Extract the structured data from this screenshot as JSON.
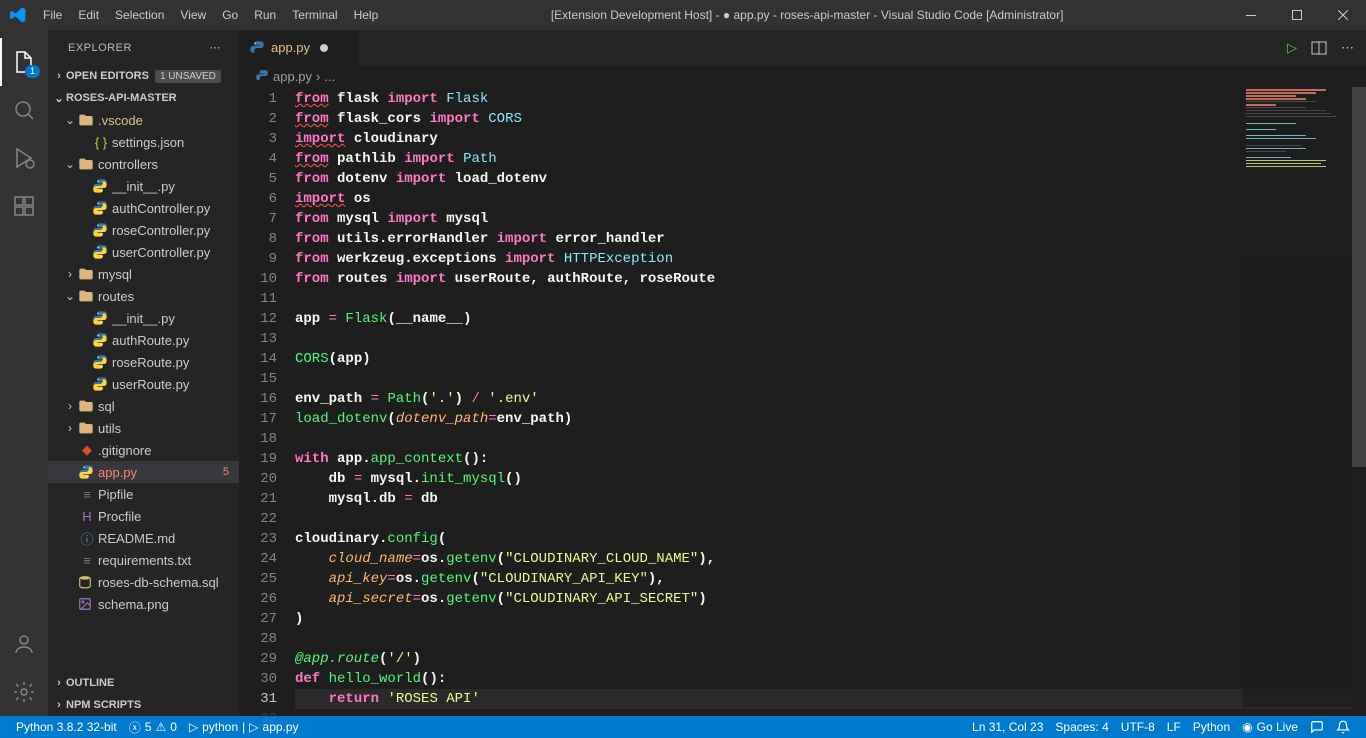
{
  "title": "[Extension Development Host] - ● app.py - roses-api-master - Visual Studio Code [Administrator]",
  "menu": [
    "File",
    "Edit",
    "Selection",
    "View",
    "Go",
    "Run",
    "Terminal",
    "Help"
  ],
  "explorer": {
    "title": "EXPLORER",
    "openEditors": "OPEN EDITORS",
    "unsavedBadge": "1 UNSAVED",
    "root": "ROSES-API-MASTER",
    "outline": "OUTLINE",
    "npm": "NPM SCRIPTS"
  },
  "tree": [
    {
      "d": 1,
      "t": "folder",
      "open": true,
      "name": ".vscode",
      "mod": true
    },
    {
      "d": 2,
      "t": "json",
      "name": "settings.json"
    },
    {
      "d": 1,
      "t": "folder",
      "open": true,
      "name": "controllers"
    },
    {
      "d": 2,
      "t": "py",
      "name": "__init__.py"
    },
    {
      "d": 2,
      "t": "py",
      "name": "authController.py"
    },
    {
      "d": 2,
      "t": "py",
      "name": "roseController.py"
    },
    {
      "d": 2,
      "t": "py",
      "name": "userController.py"
    },
    {
      "d": 1,
      "t": "folder",
      "open": false,
      "name": "mysql"
    },
    {
      "d": 1,
      "t": "folder",
      "open": true,
      "name": "routes"
    },
    {
      "d": 2,
      "t": "py",
      "name": "__init__.py"
    },
    {
      "d": 2,
      "t": "py",
      "name": "authRoute.py"
    },
    {
      "d": 2,
      "t": "py",
      "name": "roseRoute.py"
    },
    {
      "d": 2,
      "t": "py",
      "name": "userRoute.py"
    },
    {
      "d": 1,
      "t": "folder",
      "open": false,
      "name": "sql"
    },
    {
      "d": 1,
      "t": "folder",
      "open": false,
      "name": "utils"
    },
    {
      "d": 1,
      "t": "gitignore",
      "name": ".gitignore"
    },
    {
      "d": 1,
      "t": "py",
      "name": "app.py",
      "err": true,
      "sel": true,
      "decor": "5"
    },
    {
      "d": 1,
      "t": "txt",
      "name": "Pipfile"
    },
    {
      "d": 1,
      "t": "procfile",
      "name": "Procfile"
    },
    {
      "d": 1,
      "t": "md",
      "name": "README.md"
    },
    {
      "d": 1,
      "t": "txt",
      "name": "requirements.txt"
    },
    {
      "d": 1,
      "t": "sql",
      "name": "roses-db-schema.sql"
    },
    {
      "d": 1,
      "t": "png",
      "name": "schema.png"
    }
  ],
  "tab": {
    "name": "app.py",
    "dirty": true
  },
  "breadcrumb": {
    "file": "app.py",
    "more": "..."
  },
  "code": {
    "lines": [
      [
        [
          "kw-pink-u",
          "from"
        ],
        [
          "plain",
          " flask "
        ],
        [
          "kw-pink",
          "import"
        ],
        [
          "plain",
          " "
        ],
        [
          "cls",
          "Flask"
        ]
      ],
      [
        [
          "kw-pink-u",
          "from"
        ],
        [
          "plain",
          " flask_cors "
        ],
        [
          "kw-pink",
          "import"
        ],
        [
          "plain",
          " "
        ],
        [
          "cls",
          "CORS"
        ]
      ],
      [
        [
          "kw-pink-u",
          "import"
        ],
        [
          "plain",
          " cloudinary"
        ]
      ],
      [
        [
          "kw-pink-u",
          "from"
        ],
        [
          "plain",
          " pathlib "
        ],
        [
          "kw-pink",
          "import"
        ],
        [
          "plain",
          " "
        ],
        [
          "cls",
          "Path"
        ]
      ],
      [
        [
          "kw-pink",
          "from"
        ],
        [
          "plain",
          " dotenv "
        ],
        [
          "kw-pink",
          "import"
        ],
        [
          "plain",
          " load_dotenv"
        ]
      ],
      [
        [
          "kw-pink-u",
          "import"
        ],
        [
          "plain",
          " os"
        ]
      ],
      [
        [
          "kw-pink",
          "from"
        ],
        [
          "plain",
          " mysql "
        ],
        [
          "kw-pink",
          "import"
        ],
        [
          "plain",
          " mysql"
        ]
      ],
      [
        [
          "kw-pink",
          "from"
        ],
        [
          "plain",
          " utils.errorHandler "
        ],
        [
          "kw-pink",
          "import"
        ],
        [
          "plain",
          " error_handler"
        ]
      ],
      [
        [
          "kw-pink",
          "from"
        ],
        [
          "plain",
          " werkzeug.exceptions "
        ],
        [
          "kw-pink",
          "import"
        ],
        [
          "plain",
          " "
        ],
        [
          "cls",
          "HTTPException"
        ]
      ],
      [
        [
          "kw-pink",
          "from"
        ],
        [
          "plain",
          " routes "
        ],
        [
          "kw-pink",
          "import"
        ],
        [
          "plain",
          " userRoute, authRoute, roseRoute"
        ]
      ],
      [],
      [
        [
          "plain",
          "app "
        ],
        [
          "op",
          "="
        ],
        [
          "plain",
          " "
        ],
        [
          "fn",
          "Flask"
        ],
        [
          "plain",
          "("
        ],
        [
          "plain",
          "__name__"
        ],
        [
          "plain",
          ")"
        ]
      ],
      [],
      [
        [
          "fn",
          "CORS"
        ],
        [
          "plain",
          "(app)"
        ]
      ],
      [],
      [
        [
          "plain",
          "env_path "
        ],
        [
          "op",
          "="
        ],
        [
          "plain",
          " "
        ],
        [
          "fn",
          "Path"
        ],
        [
          "plain",
          "("
        ],
        [
          "str",
          "'.'"
        ],
        [
          "plain",
          ") "
        ],
        [
          "op",
          "/"
        ],
        [
          "plain",
          " "
        ],
        [
          "str",
          "'.env'"
        ]
      ],
      [
        [
          "fn",
          "load_dotenv"
        ],
        [
          "plain",
          "("
        ],
        [
          "param",
          "dotenv_path"
        ],
        [
          "op",
          "="
        ],
        [
          "plain",
          "env_path)"
        ]
      ],
      [],
      [
        [
          "kw-pink",
          "with"
        ],
        [
          "plain",
          " app."
        ],
        [
          "fn",
          "app_context"
        ],
        [
          "plain",
          "():"
        ]
      ],
      [
        [
          "plain",
          "    db "
        ],
        [
          "op",
          "="
        ],
        [
          "plain",
          " mysql."
        ],
        [
          "fn",
          "init_mysql"
        ],
        [
          "plain",
          "()"
        ]
      ],
      [
        [
          "plain",
          "    mysql.db "
        ],
        [
          "op",
          "="
        ],
        [
          "plain",
          " db"
        ]
      ],
      [],
      [
        [
          "plain",
          "cloudinary."
        ],
        [
          "fn",
          "config"
        ],
        [
          "plain",
          "("
        ]
      ],
      [
        [
          "plain",
          "    "
        ],
        [
          "param",
          "cloud_name"
        ],
        [
          "op",
          "="
        ],
        [
          "plain",
          "os."
        ],
        [
          "fn",
          "getenv"
        ],
        [
          "plain",
          "("
        ],
        [
          "str",
          "\"CLOUDINARY_CLOUD_NAME\""
        ],
        [
          "plain",
          "),"
        ]
      ],
      [
        [
          "plain",
          "    "
        ],
        [
          "param",
          "api_key"
        ],
        [
          "op",
          "="
        ],
        [
          "plain",
          "os."
        ],
        [
          "fn",
          "getenv"
        ],
        [
          "plain",
          "("
        ],
        [
          "str",
          "\"CLOUDINARY_API_KEY\""
        ],
        [
          "plain",
          "),"
        ]
      ],
      [
        [
          "plain",
          "    "
        ],
        [
          "param",
          "api_secret"
        ],
        [
          "op",
          "="
        ],
        [
          "plain",
          "os."
        ],
        [
          "fn",
          "getenv"
        ],
        [
          "plain",
          "("
        ],
        [
          "str",
          "\"CLOUDINARY_API_SECRET\""
        ],
        [
          "plain",
          ")"
        ]
      ],
      [
        [
          "plain",
          ")"
        ]
      ],
      [],
      [
        [
          "deco",
          "@app.route"
        ],
        [
          "plain",
          "("
        ],
        [
          "str",
          "'/'"
        ],
        [
          "plain",
          ")"
        ]
      ],
      [
        [
          "kw-pink",
          "def"
        ],
        [
          "plain",
          " "
        ],
        [
          "fn",
          "hello_world"
        ],
        [
          "plain",
          "():"
        ]
      ],
      [
        [
          "plain",
          "    "
        ],
        [
          "kw-pink",
          "return"
        ],
        [
          "plain",
          " "
        ],
        [
          "str",
          "'ROSES API'"
        ]
      ]
    ],
    "activeLine": 31
  },
  "status": {
    "python": "Python 3.8.2 32-bit",
    "errors": "5",
    "warnings": "0",
    "runwith": "python",
    "file": "app.py",
    "pos": "Ln 31, Col 23",
    "spaces": "Spaces: 4",
    "enc": "UTF-8",
    "eol": "LF",
    "lang": "Python",
    "golive": "Go Live"
  }
}
